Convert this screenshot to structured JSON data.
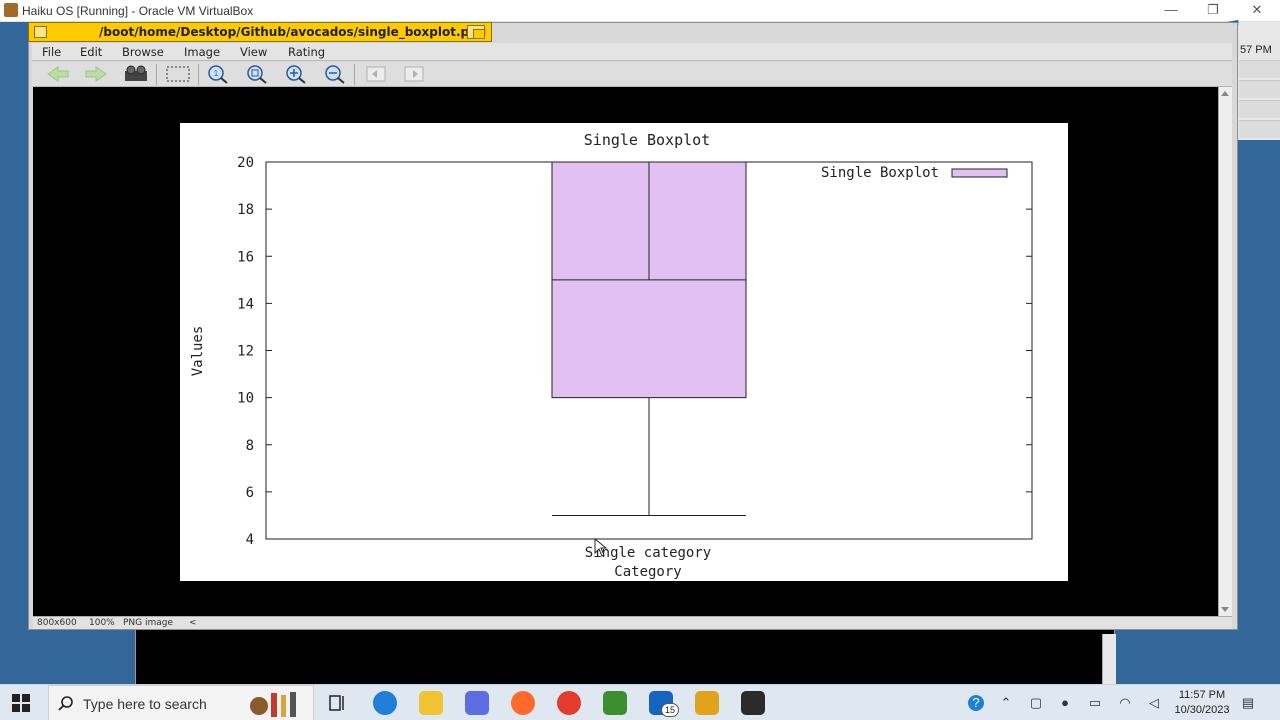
{
  "host": {
    "title": "Haiku OS  [Running] - Oracle VM VirtualBox",
    "minimize_glyph": "—",
    "restore_glyph": "❐",
    "close_glyph": "✕"
  },
  "guest": {
    "deskbar_clock": "57 PM"
  },
  "showimage": {
    "path": "/boot/home/Desktop/Github/avocados/single_boxplot.png",
    "menus": [
      "File",
      "Edit",
      "Browse",
      "Image",
      "View",
      "Rating"
    ],
    "toolbar_icons": [
      "back-arrow-icon",
      "forward-arrow-icon",
      "slideshow-projector-icon",
      "selection-icon",
      "original-size-icon",
      "fit-to-window-icon",
      "zoom-in-icon",
      "zoom-out-icon",
      "previous-page-icon",
      "next-page-icon"
    ],
    "status": {
      "dimensions": "800x600",
      "zoom": "100%",
      "type": "PNG image",
      "scroll_left": "<"
    }
  },
  "chart_data": {
    "type": "box",
    "title": "Single Boxplot",
    "xlabel": "Category",
    "ylabel": "Values",
    "categories": [
      "Single category"
    ],
    "legend": "Single Boxplot",
    "legend_position": "top-right",
    "ylim": [
      4,
      20
    ],
    "yticks": [
      4,
      6,
      8,
      10,
      12,
      14,
      16,
      18,
      20
    ],
    "tick_labels": [
      "4",
      "6",
      "8",
      "10",
      "12",
      "14",
      "16",
      "18",
      "20"
    ],
    "box": {
      "whisker_low": 5,
      "q1": 10,
      "median": 15,
      "q3": 20,
      "whisker_high": 20
    },
    "colors": {
      "box_fill": "#e3c0f2",
      "box_stroke": "#222222"
    }
  },
  "taskbar": {
    "search_placeholder": "Type here to search",
    "mail_badge": "15",
    "time": "11:57 PM",
    "date": "10/30/2023"
  }
}
